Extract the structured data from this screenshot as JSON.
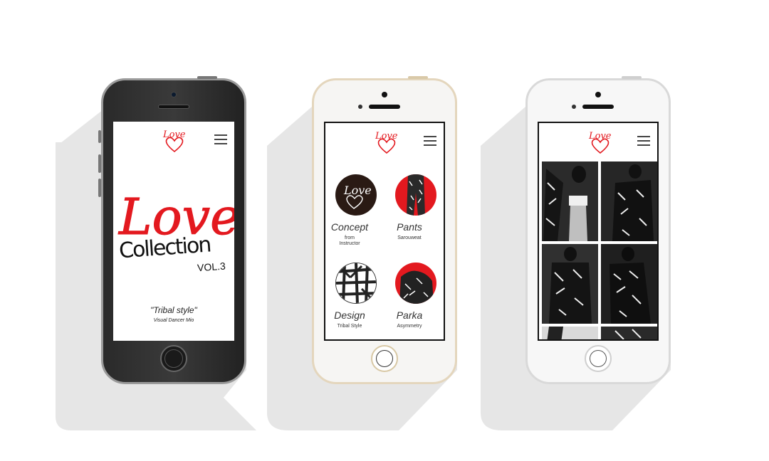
{
  "phones": {
    "left": {
      "screen": {
        "title_love": "Love",
        "title_collection": "Collection",
        "volume": "VOL.3",
        "tagline": "\"Tribal style\"",
        "byline": "Visual Dancer Mio"
      }
    },
    "middle": {
      "items": [
        {
          "title": "Concept",
          "subtitle": "from\nInstructor"
        },
        {
          "title": "Pants",
          "subtitle": "Sarouweat"
        },
        {
          "title": "Design",
          "subtitle": "Tribal Style"
        },
        {
          "title": "Parka",
          "subtitle": "Asymmetry"
        }
      ]
    },
    "right": {
      "gallery_count": 6
    }
  },
  "logo_text": "Love",
  "colors": {
    "accent_red": "#e3191f",
    "shadow": "#e6e6e6",
    "ink": "#111111"
  },
  "icons": {
    "menu": "hamburger-menu-icon",
    "logo": "love-heart-logo"
  }
}
